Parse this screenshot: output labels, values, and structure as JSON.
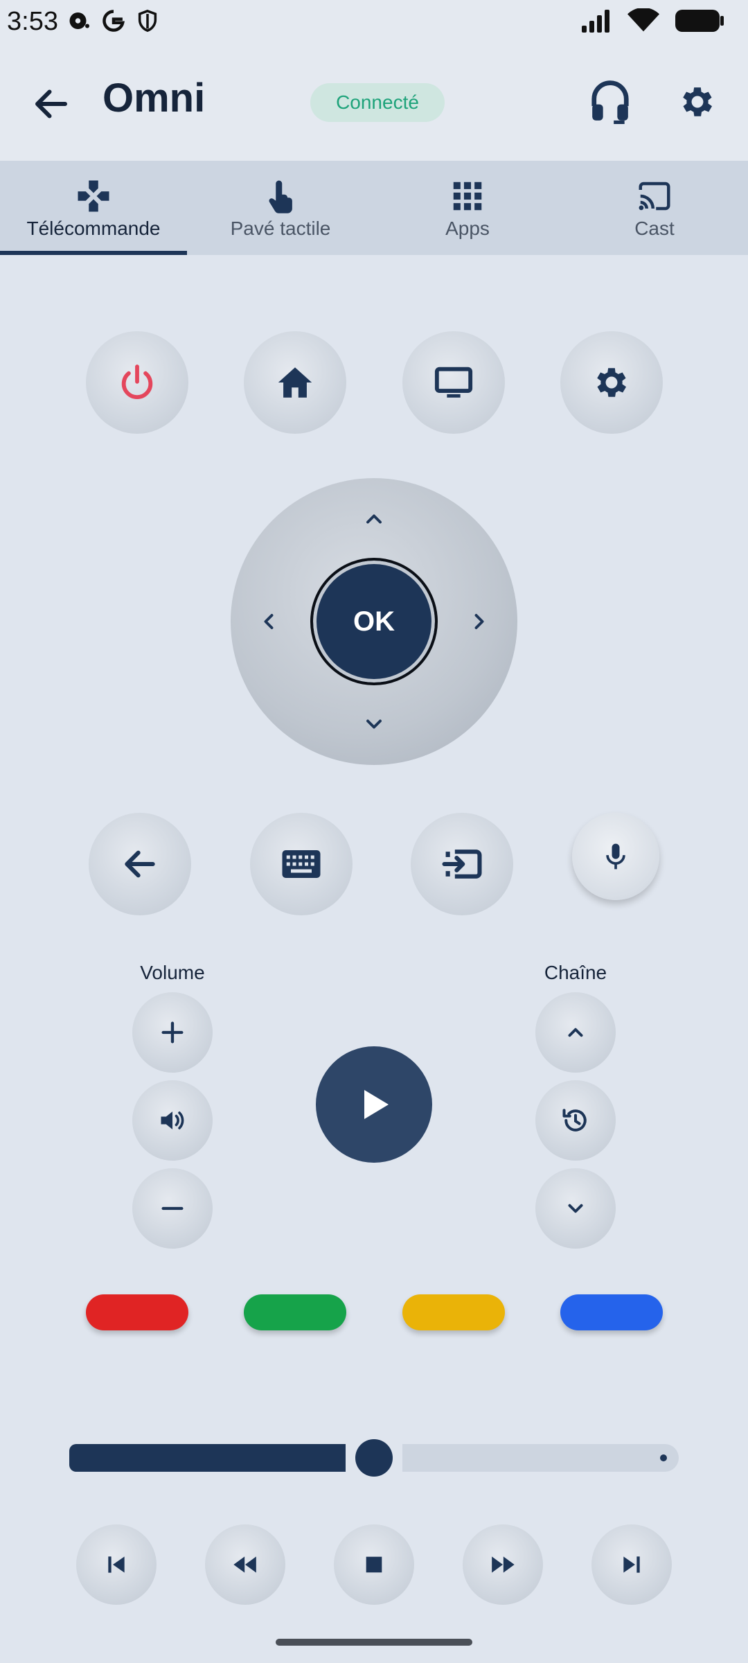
{
  "status_bar": {
    "time": "3:53"
  },
  "app_bar": {
    "title": "Omni",
    "status": "Connecté"
  },
  "tabs": [
    {
      "label": "Télécommande",
      "icon": "gamepad-icon",
      "active": true
    },
    {
      "label": "Pavé tactile",
      "icon": "touch-icon",
      "active": false
    },
    {
      "label": "Apps",
      "icon": "apps-grid-icon",
      "active": false
    },
    {
      "label": "Cast",
      "icon": "cast-icon",
      "active": false
    }
  ],
  "top_row": [
    "power-icon",
    "home-icon",
    "tv-icon",
    "settings-icon"
  ],
  "dpad": {
    "ok_label": "OK"
  },
  "middle_row": [
    "back-arrow-icon",
    "keyboard-icon",
    "input-source-icon",
    "microphone-icon"
  ],
  "volume": {
    "label": "Volume"
  },
  "channel": {
    "label": "Chaîne"
  },
  "color_buttons": {
    "red": "#e02424",
    "green": "#16a34a",
    "yellow": "#eab308",
    "blue": "#2563eb"
  },
  "media": {
    "progress_percent": 50
  },
  "colors": {
    "accent": "#1d3557",
    "status_green": "#1ea37a",
    "power_red": "#e4465c"
  }
}
